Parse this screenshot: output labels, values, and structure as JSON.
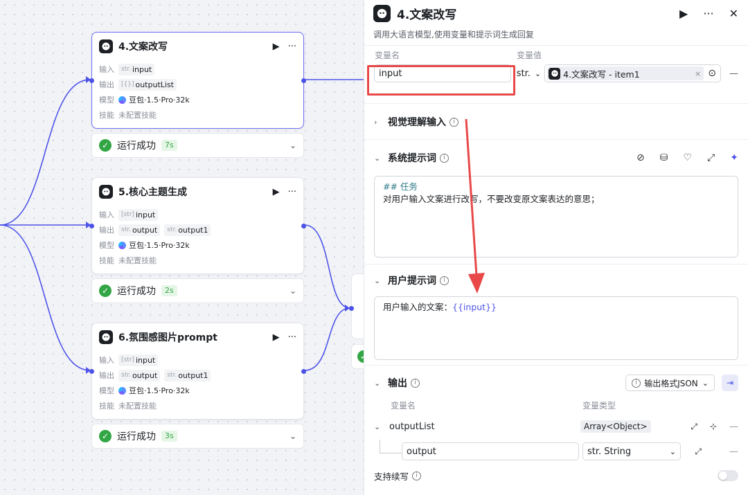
{
  "canvas": {
    "nodes": [
      {
        "title": "4.文案改写",
        "input_label": "输入",
        "inputs": [
          {
            "prefix": "str.",
            "name": "input"
          }
        ],
        "output_label": "输出",
        "outputs": [
          {
            "prefix": "[{}]",
            "name": "outputList"
          }
        ],
        "model_label": "模型",
        "model": "豆包·1.5·Pro·32k",
        "skill_label": "技能",
        "skill": "未配置技能",
        "status": "运行成功",
        "time": "7s"
      },
      {
        "title": "5.核心主题生成",
        "input_label": "输入",
        "inputs": [
          {
            "prefix": "[str]",
            "name": "input"
          }
        ],
        "output_label": "输出",
        "outputs": [
          {
            "prefix": "str.",
            "name": "output"
          },
          {
            "prefix": "str.",
            "name": "output1"
          }
        ],
        "model_label": "模型",
        "model": "豆包·1.5·Pro·32k",
        "skill_label": "技能",
        "skill": "未配置技能",
        "status": "运行成功",
        "time": "2s"
      },
      {
        "title": "6.氛围感图片prompt",
        "input_label": "输入",
        "inputs": [
          {
            "prefix": "[str]",
            "name": "input"
          }
        ],
        "output_label": "输出",
        "outputs": [
          {
            "prefix": "str.",
            "name": "output"
          },
          {
            "prefix": "str.",
            "name": "output1"
          }
        ],
        "model_label": "模型",
        "model": "豆包·1.5·Pro·32k",
        "skill_label": "技能",
        "skill": "未配置技能",
        "status": "运行成功",
        "time": "3s"
      }
    ]
  },
  "panel": {
    "title": "4.文案改写",
    "description": "调用大语言模型,使用变量和提示词生成回复",
    "input_section": {
      "col_name": "变量名",
      "col_value": "变量值",
      "var_name": "input",
      "type": "str.",
      "ref_value": "4.文案改写 - item1"
    },
    "vision": {
      "title": "视觉理解输入"
    },
    "system_prompt": {
      "title": "系统提示词",
      "line1": "## 任务",
      "line2": "对用户输入文案进行改写，不要改变原文案表达的意思；"
    },
    "user_prompt": {
      "title": "用户提示词",
      "text": "用户输入的文案：",
      "var": "{{input}}"
    },
    "output": {
      "title": "输出",
      "format": "输出格式JSON",
      "col_name": "变量名",
      "col_type": "变量类型",
      "list_name": "outputList",
      "list_type": "Array<Object>",
      "child_name": "output",
      "child_type": "str. String"
    },
    "continue": {
      "label": "支持续写"
    }
  },
  "colors": {
    "accent": "#4d53e8",
    "success": "#32a645",
    "highlight": "#e84848"
  }
}
